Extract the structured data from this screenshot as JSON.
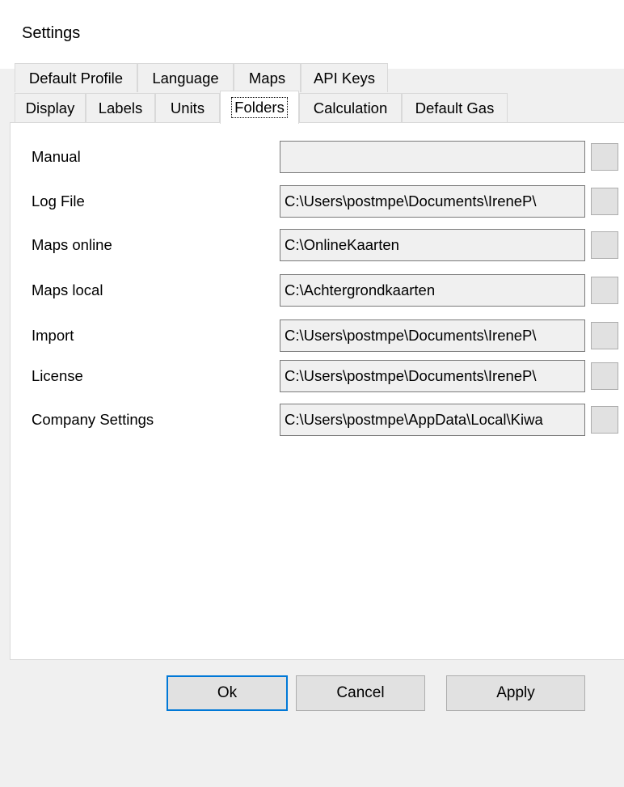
{
  "window": {
    "title": "Settings"
  },
  "tabs": {
    "row1": [
      {
        "label": "Default Profile"
      },
      {
        "label": "Language"
      },
      {
        "label": "Maps"
      },
      {
        "label": "API Keys"
      }
    ],
    "row2": [
      {
        "label": "Display"
      },
      {
        "label": "Labels"
      },
      {
        "label": "Units"
      },
      {
        "label": "Folders",
        "selected": true
      },
      {
        "label": "Calculation"
      },
      {
        "label": "Default Gas"
      }
    ]
  },
  "folders": {
    "rows": [
      {
        "label": "Manual",
        "value": ""
      },
      {
        "label": "Log File",
        "value": "C:\\Users\\postmpe\\Documents\\IreneP\\"
      },
      {
        "label": "Maps online",
        "value": "C:\\OnlineKaarten"
      },
      {
        "label": "Maps local",
        "value": "C:\\Achtergrondkaarten"
      },
      {
        "label": "Import",
        "value": "C:\\Users\\postmpe\\Documents\\IreneP\\"
      },
      {
        "label": "License",
        "value": "C:\\Users\\postmpe\\Documents\\IreneP\\"
      },
      {
        "label": "Company Settings",
        "value": "C:\\Users\\postmpe\\AppData\\Local\\Kiwa"
      }
    ]
  },
  "buttons": {
    "ok": "Ok",
    "cancel": "Cancel",
    "apply": "Apply"
  },
  "colors": {
    "window_bg": "#f0f0f0",
    "panel_bg": "#ffffff",
    "input_bg": "#f0f0f0",
    "input_border": "#7a7a7a",
    "button_bg": "#e1e1e1",
    "button_border": "#adadad",
    "default_button_border": "#0078d7"
  }
}
